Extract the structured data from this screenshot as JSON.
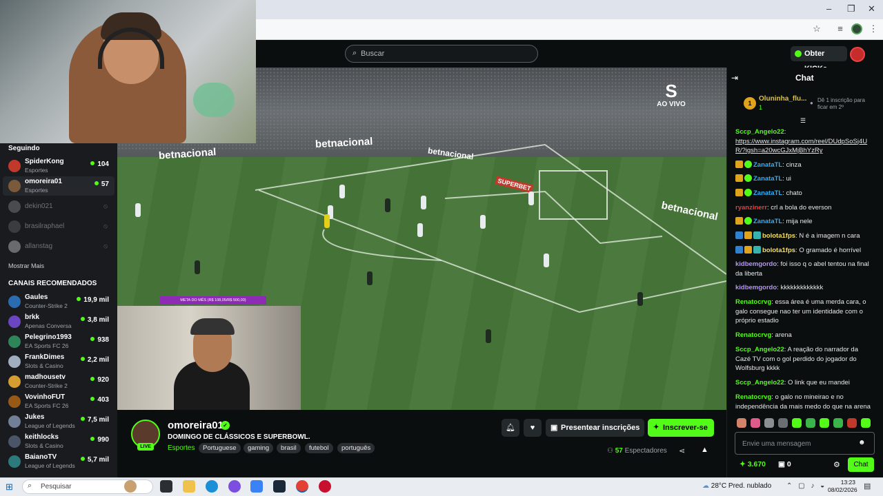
{
  "header": {
    "search_placeholder": "Buscar",
    "kicks_button": "Obter KICKs"
  },
  "sidebar": {
    "following_heading": "Seguindo",
    "following": [
      {
        "name": "SpiderKong",
        "category": "Esportes",
        "viewers": "104",
        "color": "#c0392b"
      },
      {
        "name": "omoreira01",
        "category": "Esportes",
        "viewers": "57",
        "color": "#7a5a3a"
      }
    ],
    "offline": [
      {
        "name": "dekin021",
        "color": "#888"
      },
      {
        "name": "brasilraphael",
        "color": "#666"
      },
      {
        "name": "allanstag",
        "color": "#ccc"
      }
    ],
    "show_more": "Mostrar Mais",
    "recommended_heading": "CANAIS RECOMENDADOS",
    "recommended": [
      {
        "name": "Gaules",
        "category": "Counter-Strike 2",
        "viewers": "19,9 mil",
        "color": "#2b6cb0"
      },
      {
        "name": "brkk",
        "category": "Apenas Conversa",
        "viewers": "3,8 mil",
        "color": "#6b46c1"
      },
      {
        "name": "Pelegrino1993",
        "category": "EA Sports FC 26",
        "viewers": "938",
        "color": "#2f855a"
      },
      {
        "name": "FrankDimes",
        "category": "Slots & Casino",
        "viewers": "2,2 mil",
        "color": "#a0aec0"
      },
      {
        "name": "madhousetv",
        "category": "Counter-Strike 2",
        "viewers": "920",
        "color": "#d69e2e"
      },
      {
        "name": "VovinhoFUT",
        "category": "EA Sports FC 26",
        "viewers": "403",
        "color": "#975a16"
      },
      {
        "name": "Jukes",
        "category": "League of Legends",
        "viewers": "7,5 mil",
        "color": "#718096"
      },
      {
        "name": "keithlocks",
        "category": "Slots & Casino",
        "viewers": "990",
        "color": "#4a5568"
      },
      {
        "name": "BaianoTV",
        "category": "League of Legends",
        "viewers": "5,7 mil",
        "color": "#2c7a7b"
      }
    ]
  },
  "video": {
    "broadcaster_logo": "S",
    "broadcaster_label": "AO VIVO",
    "ad_text_1": "betnacional",
    "ad_text_2": "SUPERBET",
    "goal_bar": "META DO MÊS (R$ 108,05/R$ 500,00)"
  },
  "stream": {
    "live_badge": "LIVE",
    "streamer": "omoreira01",
    "title": "DOMINGO DE CLÁSSICOS E SUPERBOWL.",
    "category": "Esportes",
    "tags": [
      "Portuguese",
      "gaming",
      "brasil",
      "futebol",
      "português"
    ],
    "gift_button": "Presentear inscrições",
    "subscribe_button": "Inscrever-se",
    "viewer_count": "57",
    "viewer_label": "Espectadores"
  },
  "chat": {
    "title": "Chat",
    "pinned": {
      "rank": "1",
      "name": "Oluninha_flu...",
      "count": "1",
      "note": "Dê 1 inscrição para ficar em 2º"
    },
    "messages": [
      {
        "user": "Sccp_Angelo22",
        "color": "#53fc18",
        "text": "",
        "link": "https://www.instagram.com/reel/DUdpSoSj4UR/?igsh=a20wcGJxMjBhYzRy"
      },
      {
        "user": "ZanataTL",
        "color": "#2ab0ff",
        "text": "cinza"
      },
      {
        "user": "ZanataTL",
        "color": "#2ab0ff",
        "text": "ui"
      },
      {
        "user": "ZanataTL",
        "color": "#2ab0ff",
        "text": "chato"
      },
      {
        "user": "ryanzinerr",
        "color": "#e53e3e",
        "text": "crl a bola do everson"
      },
      {
        "user": "ZanataTL",
        "color": "#2ab0ff",
        "text": "mija nele"
      },
      {
        "user": "bolota1fps",
        "color": "#f6e05e",
        "text": "N é a imagem n cara"
      },
      {
        "user": "bolota1fps",
        "color": "#f6e05e",
        "text": "O gramado é horrível"
      },
      {
        "user": "kidbemgordo",
        "color": "#b794f4",
        "text": "foi isso q o abel tentou na final da liberta"
      },
      {
        "user": "kidbemgordo",
        "color": "#b794f4",
        "text": "kkkkkkkkkkkkk"
      },
      {
        "user": "Renatocrvg",
        "color": "#53fc18",
        "text": "essa área é uma merda cara, o galo consegue nao ter um identidade com o próprio estadio"
      },
      {
        "user": "Renatocrvg",
        "color": "#53fc18",
        "text": "arena"
      },
      {
        "user": "Sccp_Angelo22",
        "color": "#53fc18",
        "text": "A reação do narrador da Cazé TV com o gol perdido do jogador do Wolfsburg kkkk"
      },
      {
        "user": "Sccp_Angelo22",
        "color": "#53fc18",
        "text": "O link que eu mandei"
      },
      {
        "user": "Renatocrvg",
        "color": "#53fc18",
        "text": "o galo no mineirao e no independência da mais medo do que na arena"
      }
    ],
    "input_placeholder": "Envie uma mensagem",
    "kicks_balance": "3.670",
    "subs_balance": "0",
    "send_button": "Chat"
  },
  "taskbar": {
    "search_label": "Pesquisar",
    "weather": "28°C  Pred. nublado",
    "time": "13:23",
    "date": "08/02/2026"
  },
  "colors": {
    "accent": "#53fc18",
    "background": "#0b0e0f",
    "sidebar": "#191b1f"
  }
}
